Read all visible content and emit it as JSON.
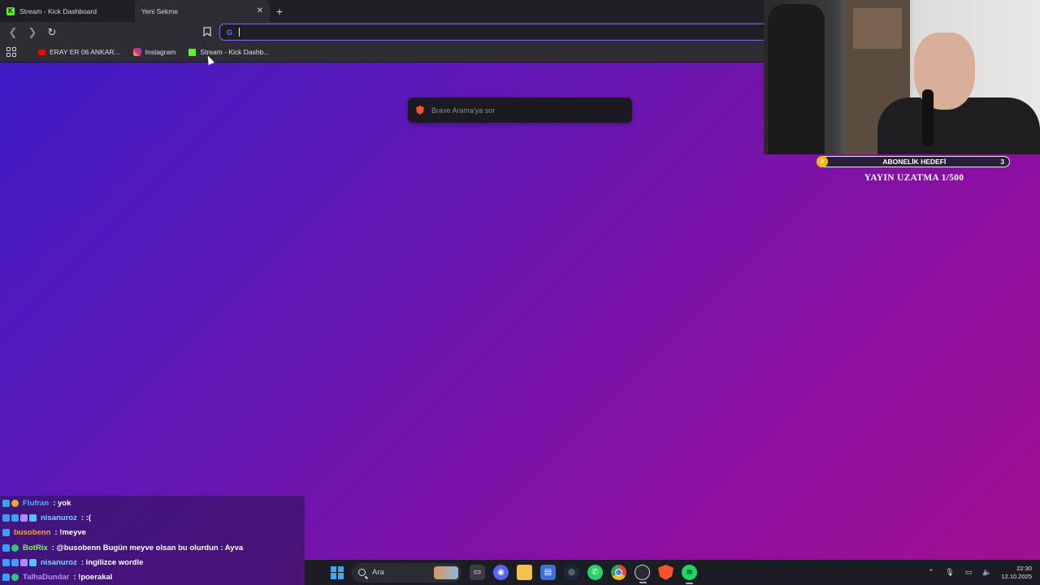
{
  "browser": {
    "tabs": [
      {
        "title": "Stream - Kick Dashboard",
        "active": false
      },
      {
        "title": "Yeni Sekme",
        "active": true
      }
    ],
    "new_tab": "+",
    "address": {
      "value": "",
      "engine_icon": "G"
    },
    "bookmarks": [
      {
        "label": "ERAY ER 06 ANKAR...",
        "icon": "youtube-icon"
      },
      {
        "label": "Instagram",
        "icon": "instagram-icon"
      },
      {
        "label": "Stream - Kick Dashb...",
        "icon": "kick-icon"
      }
    ]
  },
  "brave_ask": {
    "placeholder": "Brave Arama'ya sor"
  },
  "overlay": {
    "goal": {
      "title": "ABONELİK HEDEFİ",
      "current": "0",
      "target": "3",
      "progress": 0.0
    },
    "extend_text": "YAYIN UZATMA 1/500"
  },
  "chat": [
    {
      "user": "Flufran",
      "color": "#4fb3ff",
      "message": ": yok",
      "badges": [
        "b-blue",
        "b-orange"
      ]
    },
    {
      "user": "nisanuroz",
      "color": "#7fd4ff",
      "message": ": :(",
      "badges": [
        "b-blue",
        "b-blue",
        "b-gift",
        "b-sub"
      ]
    },
    {
      "user": "busobenn",
      "color": "#f5a623",
      "message": ": !meyve",
      "badges": [
        "b-blue"
      ]
    },
    {
      "user": "BotRix",
      "color": "#7cff5a",
      "message": ": @busobenn Bugün meyve olsan bu olurdun : Ayva",
      "badges": [
        "b-blue",
        "b-green"
      ]
    },
    {
      "user": "nisanuroz",
      "color": "#7fd4ff",
      "message": ": ingilizce wordle",
      "badges": [
        "b-blue",
        "b-blue",
        "b-gift",
        "b-sub"
      ]
    },
    {
      "user": "TalhaDundar",
      "color": "#b98cff",
      "message": ": !poerakal",
      "badges": [
        "b-blue",
        "b-green"
      ]
    }
  ],
  "taskbar": {
    "search_label": "Ara",
    "time": "22:30",
    "date": "12.10.2025"
  },
  "colors": {
    "accent": "#8a63ff",
    "kick_green": "#53fc18",
    "goal_yellow": "#f2b417"
  }
}
